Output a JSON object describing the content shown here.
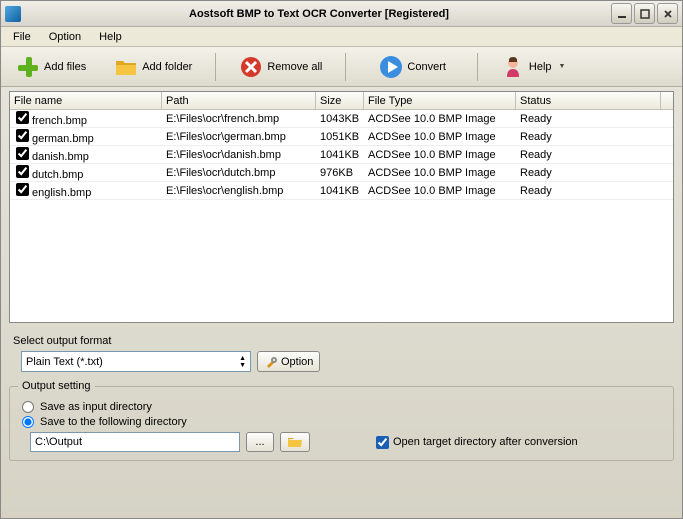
{
  "titlebar": {
    "text": "Aostsoft BMP to Text OCR Converter [Registered]"
  },
  "menu": {
    "file": "File",
    "option": "Option",
    "help": "Help"
  },
  "toolbar": {
    "add_files": "Add files",
    "add_folder": "Add folder",
    "remove_all": "Remove all",
    "convert": "Convert",
    "help": "Help"
  },
  "columns": {
    "name": "File name",
    "path": "Path",
    "size": "Size",
    "type": "File Type",
    "status": "Status"
  },
  "files": [
    {
      "checked": true,
      "name": "french.bmp",
      "path": "E:\\Files\\ocr\\french.bmp",
      "size": "1043KB",
      "type": "ACDSee 10.0 BMP Image",
      "status": "Ready"
    },
    {
      "checked": true,
      "name": "german.bmp",
      "path": "E:\\Files\\ocr\\german.bmp",
      "size": "1051KB",
      "type": "ACDSee 10.0 BMP Image",
      "status": "Ready"
    },
    {
      "checked": true,
      "name": "danish.bmp",
      "path": "E:\\Files\\ocr\\danish.bmp",
      "size": "1041KB",
      "type": "ACDSee 10.0 BMP Image",
      "status": "Ready"
    },
    {
      "checked": true,
      "name": "dutch.bmp",
      "path": "E:\\Files\\ocr\\dutch.bmp",
      "size": "976KB",
      "type": "ACDSee 10.0 BMP Image",
      "status": "Ready"
    },
    {
      "checked": true,
      "name": "english.bmp",
      "path": "E:\\Files\\ocr\\english.bmp",
      "size": "1041KB",
      "type": "ACDSee 10.0 BMP Image",
      "status": "Ready"
    }
  ],
  "format": {
    "section_label": "Select output format",
    "selected": "Plain Text (*.txt)",
    "option_button": "Option"
  },
  "output": {
    "group_label": "Output setting",
    "save_as_input": "Save as input directory",
    "save_following": "Save to the following directory",
    "selected_mode": "following",
    "path": "C:\\Output",
    "browse": "...",
    "open_target_checked": true,
    "open_target_label": "Open target directory after conversion"
  }
}
